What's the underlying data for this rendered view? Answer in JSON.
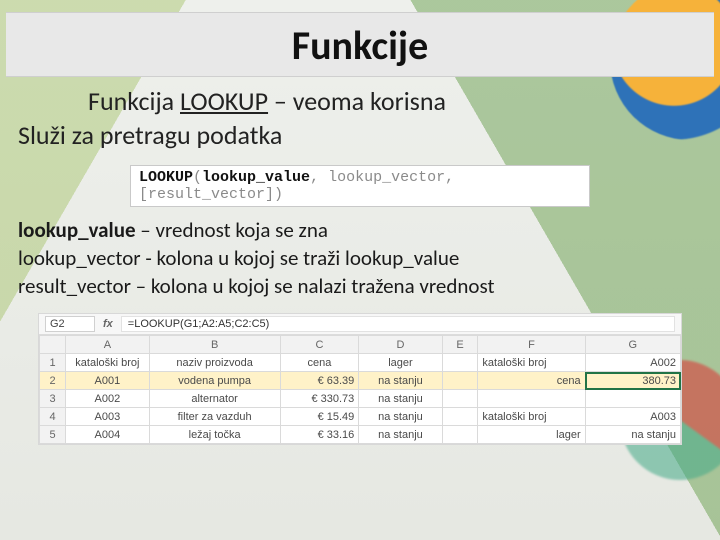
{
  "title": "Funkcije",
  "intro": {
    "prefix": "Funkcija ",
    "fn": "LOOKUP",
    "suffix": " – veoma korisna",
    "line2": "Služi za pretragu podatka"
  },
  "syntax": {
    "fn": "LOOKUP",
    "open": "(",
    "arg1": "lookup_value",
    "rest": ", lookup_vector, [result_vector])"
  },
  "params": {
    "p1_bold": "lookup_value",
    "p1_rest": " – vrednost koja se zna",
    "p2": "lookup_vector - kolona u kojoj se traži lookup_value",
    "p3": "result_vector – kolona u kojoj se nalazi tražena vrednost"
  },
  "sheet": {
    "cellref": "G2",
    "fx": "fx",
    "formula": "=LOOKUP(G1;A2:A5;C2:C5)",
    "cols": [
      "",
      "A",
      "B",
      "C",
      "D",
      "E",
      "F",
      "G"
    ],
    "rows": [
      {
        "n": "1",
        "A": "kataloški broj",
        "B": "naziv proizvoda",
        "C": "cena",
        "D": "lager",
        "E": "",
        "F": "kataloški broj",
        "G": "A002"
      },
      {
        "n": "2",
        "A": "A001",
        "B": "vodena pumpa",
        "C": "€ 63.39",
        "D": "na stanju",
        "E": "",
        "F": "cena",
        "G": "380.73",
        "hl": true,
        "sel": "G"
      },
      {
        "n": "3",
        "A": "A002",
        "B": "alternator",
        "C": "€ 330.73",
        "D": "na stanju",
        "E": "",
        "F": "",
        "G": ""
      },
      {
        "n": "4",
        "A": "A003",
        "B": "filter za vazduh",
        "C": "€ 15.49",
        "D": "na stanju",
        "E": "",
        "F": "kataloški broj",
        "G": "A003"
      },
      {
        "n": "5",
        "A": "A004",
        "B": "ležaj točka",
        "C": "€ 33.16",
        "D": "na stanju",
        "E": "",
        "F": "lager",
        "G": "na stanju"
      }
    ]
  }
}
